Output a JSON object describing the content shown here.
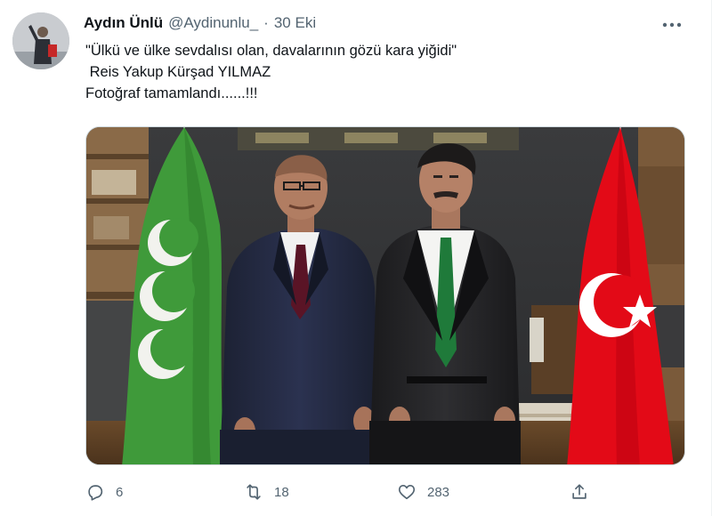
{
  "tweet": {
    "author_name": "Aydın Ünlü",
    "handle": "@Aydinunlu_",
    "separator": "·",
    "date": "30 Eki",
    "text_lines": [
      "\"Ülkü ve ülke sevdalısı olan, davalarının gözü kara yiğidi\"",
      " Reis Yakup Kürşad YILMAZ",
      "Fotoğraf tamamlandı......!!!"
    ],
    "media_icon": "photo",
    "more_icon": "more-horizontal-icon"
  },
  "actions": {
    "reply": {
      "icon": "reply-icon",
      "count": "6"
    },
    "retweet": {
      "icon": "retweet-icon",
      "count": "18"
    },
    "like": {
      "icon": "heart-icon",
      "count": "283"
    },
    "share": {
      "icon": "share-icon",
      "count": ""
    }
  },
  "colors": {
    "text_primary": "#0f1419",
    "text_secondary": "#536471",
    "border": "#cfd9de",
    "turkish_flag": "#e30a17",
    "green_flag": "#3f9a3a"
  }
}
